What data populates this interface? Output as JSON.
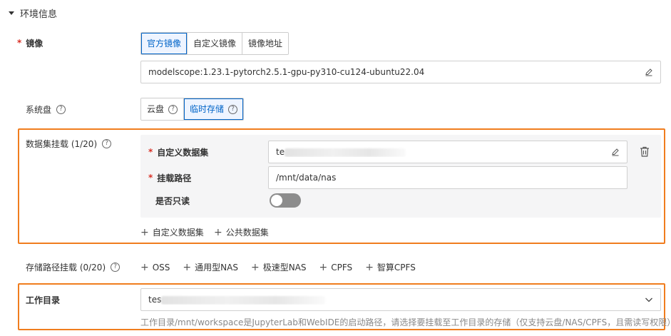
{
  "section": {
    "title": "环境信息"
  },
  "image": {
    "label": "镜像",
    "options": [
      "官方镜像",
      "自定义镜像",
      "镜像地址"
    ],
    "selected": "官方镜像",
    "value": "modelscope:1.23.1-pytorch2.5.1-gpu-py310-cu124-ubuntu22.04"
  },
  "disk": {
    "label": "系统盘",
    "options": [
      "云盘",
      "临时存储"
    ],
    "selected": "临时存储"
  },
  "dataset_mount": {
    "label": "数据集挂载 (1/20)",
    "custom_dataset_label": "自定义数据集",
    "custom_dataset_value": "te",
    "mount_path_label": "挂载路径",
    "mount_path_value": "/mnt/data/nas",
    "readonly_label": "是否只读",
    "readonly": false,
    "add_custom": "自定义数据集",
    "add_public": "公共数据集"
  },
  "storage_mount": {
    "label": "存储路径挂载 (0/20)",
    "options": [
      "OSS",
      "通用型NAS",
      "极速型NAS",
      "CPFS",
      "智算CPFS"
    ]
  },
  "workdir": {
    "label": "工作目录",
    "value": "tes",
    "hint": "工作目录/mnt/workspace是JupyterLab和WebIDE的启动路径，请选择要挂载至工作目录的存储（仅支持云盘/NAS/CPFS，且需读写权限）"
  },
  "colors": {
    "accent": "#0064c8",
    "highlight": "#f07d1e",
    "required": "#d93026"
  }
}
